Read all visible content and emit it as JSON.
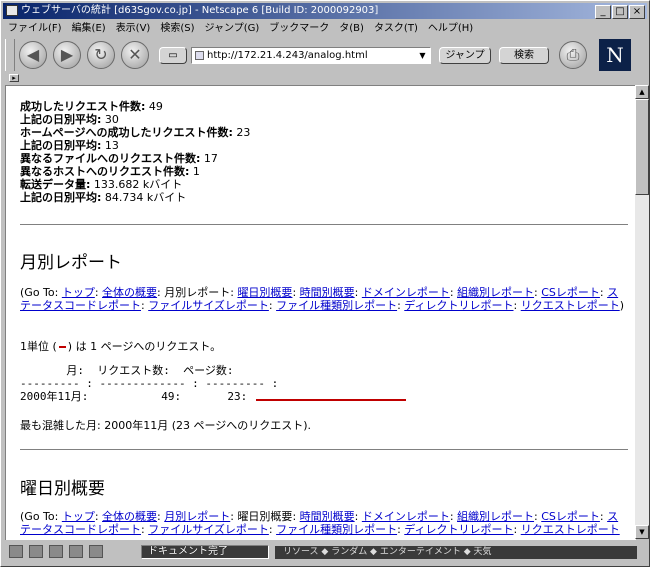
{
  "window": {
    "title": "ウェブサーバの統計 [d63Sgov.co.jp] - Netscape 6 [Build ID: 2000092903]"
  },
  "menu": [
    "ファイル(F)",
    "編集(E)",
    "表示(V)",
    "検索(S)",
    "ジャンプ(G)",
    "ブックマーク",
    "タ(B)",
    "タスク(T)",
    "ヘルプ(H)"
  ],
  "toolbar": {
    "url": "http://172.21.4.243/analog.html",
    "jump_label": "ジャンプ",
    "search_label": "検索",
    "logo": "N"
  },
  "summary": [
    {
      "label": "成功したリクエスト件数:",
      "value": "49"
    },
    {
      "label": "上記の日別平均:",
      "value": "30"
    },
    {
      "label": "ホームページへの成功したリクエスト件数:",
      "value": "23"
    },
    {
      "label": "上記の日別平均:",
      "value": "13"
    },
    {
      "label": "異なるファイルへのリクエスト件数:",
      "value": "17"
    },
    {
      "label": "異なるホストへのリクエスト件数:",
      "value": "1"
    },
    {
      "label": "転送データ量:",
      "value": "133.682 kバイト"
    },
    {
      "label": "上記の日別平均:",
      "value": "84.734 kバイト"
    }
  ],
  "monthly": {
    "title": "月別レポート",
    "goto_prefix": "(Go To:",
    "links": [
      "トップ",
      "全体の概要",
      "月別レポート",
      "曜日別概要",
      "時間別概要",
      "ドメインレポート",
      "組織別レポート",
      "CSレポート",
      "ステータスコードレポート",
      "ファイルサイズレポート",
      "ファイル種類別レポート",
      "ディレクトリレポート",
      "リクエストレポート"
    ],
    "unit_note_pre": "1単位 (",
    "unit_note_post": ") は 1 ページへのリクエスト。",
    "table_header": "       月:  リクエスト数:  ページ数:",
    "table_rule": "--------- : ------------- : --------- :",
    "table_row": "2000年11月:           49:       23:",
    "busiest": "最も混雑した月: 2000年11月 (23 ページへのリクエスト)."
  },
  "weekly": {
    "title": "曜日別概要",
    "goto_prefix": "(Go To:",
    "current": "曜日別概要",
    "links": [
      "トップ",
      "全体の概要",
      "月別レポート",
      "時間別概要",
      "ドメインレポート",
      "組織別レポート",
      "CSレポート",
      "ステータスコードレポート",
      "ファイルサイズレポート",
      "ファイル種類別レポート",
      "ディレクトリレポート",
      "リクエストレポート"
    ]
  },
  "status": {
    "text": "ドキュメント完了",
    "task": "リソース ◆ ランダム ◆ エンターテイメント ◆ 天気"
  }
}
